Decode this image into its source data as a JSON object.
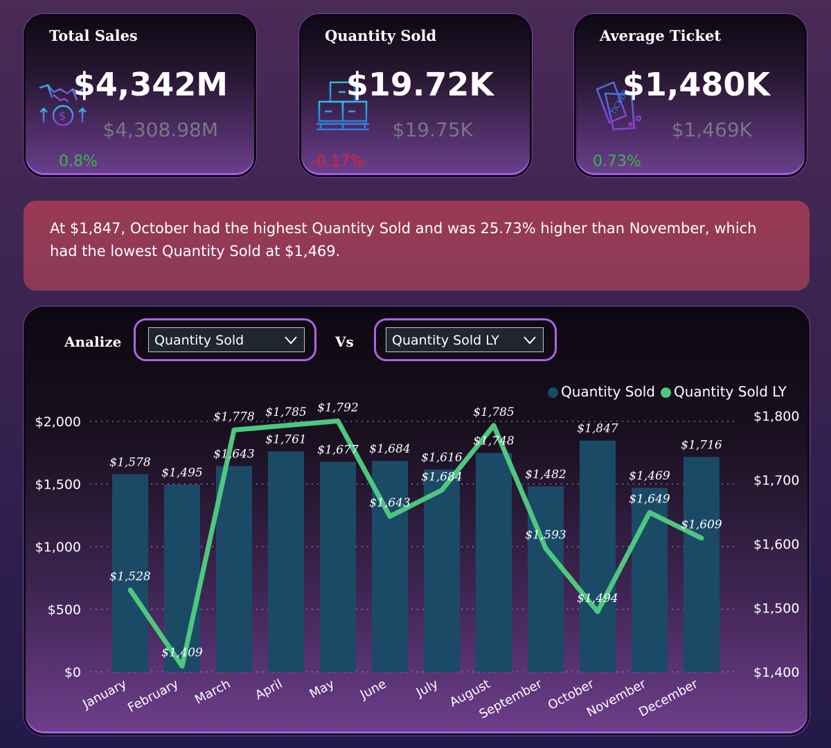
{
  "kpis": [
    {
      "title": "Total Sales",
      "value": "$4,342M",
      "previous": "$4,308.98M",
      "change": "0.8%",
      "change_color": "#3cb44b",
      "icon": "handshake-money-icon"
    },
    {
      "title": "Quantity Sold",
      "value": "$19.72K",
      "previous": "$19.75K",
      "change": "-0.17%",
      "change_color": "#e8222e",
      "icon": "boxes-pallet-icon"
    },
    {
      "title": "Average Ticket",
      "value": "$1,480K",
      "previous": "$1,469K",
      "change": "0.73%",
      "change_color": "#3cb44b",
      "icon": "ticket-icon"
    }
  ],
  "insight": "At $1,847, October had the highest Quantity Sold and was 25.73% higher than November, which had the lowest Quantity Sold at $1,469.",
  "controls": {
    "analize_label": "Analize",
    "vs_label": "Vs",
    "dropdown1_value": "Quantity Sold",
    "dropdown2_value": "Quantity Sold LY"
  },
  "colors": {
    "bar": "#1b4a67",
    "line": "#4ec77f"
  },
  "chart_data": {
    "type": "bar",
    "categories": [
      "January",
      "February",
      "March",
      "April",
      "May",
      "June",
      "July",
      "August",
      "September",
      "October",
      "November",
      "December"
    ],
    "series": [
      {
        "name": "Quantity Sold",
        "type": "bar",
        "axis": "left",
        "values": [
          1578,
          1495,
          1643,
          1761,
          1677,
          1684,
          1616,
          1748,
          1482,
          1847,
          1469,
          1716
        ],
        "labels": [
          "$1,578",
          "$1,495",
          "$1,643",
          "$1,761",
          "$1,677",
          "$1,684",
          "$1,616",
          "$1,748",
          "$1,482",
          "$1,847",
          "$1,469",
          "$1,716"
        ]
      },
      {
        "name": "Quantity Sold LY",
        "type": "line",
        "axis": "right",
        "values": [
          1528,
          1409,
          1778,
          1785,
          1792,
          1643,
          1684,
          1785,
          1593,
          1494,
          1649,
          1609
        ],
        "labels": [
          "$1,528",
          "$1,409",
          "$1,778",
          "$1,785",
          "$1,792",
          "$1,643",
          "$1,684",
          "$1,785",
          "$1,593",
          "$1,494",
          "$1,649",
          "$1,609"
        ]
      }
    ],
    "y_left": {
      "range": [
        0,
        2000
      ],
      "ticks": [
        "$0",
        "$500",
        "$1,000",
        "$1,500",
        "$2,000"
      ]
    },
    "y_right": {
      "range": [
        1400,
        1800
      ],
      "ticks": [
        "$1,400",
        "$1,500",
        "$1,600",
        "$1,700",
        "$1,800"
      ]
    },
    "grid": "dotted horizontal",
    "legend": "top-right"
  }
}
